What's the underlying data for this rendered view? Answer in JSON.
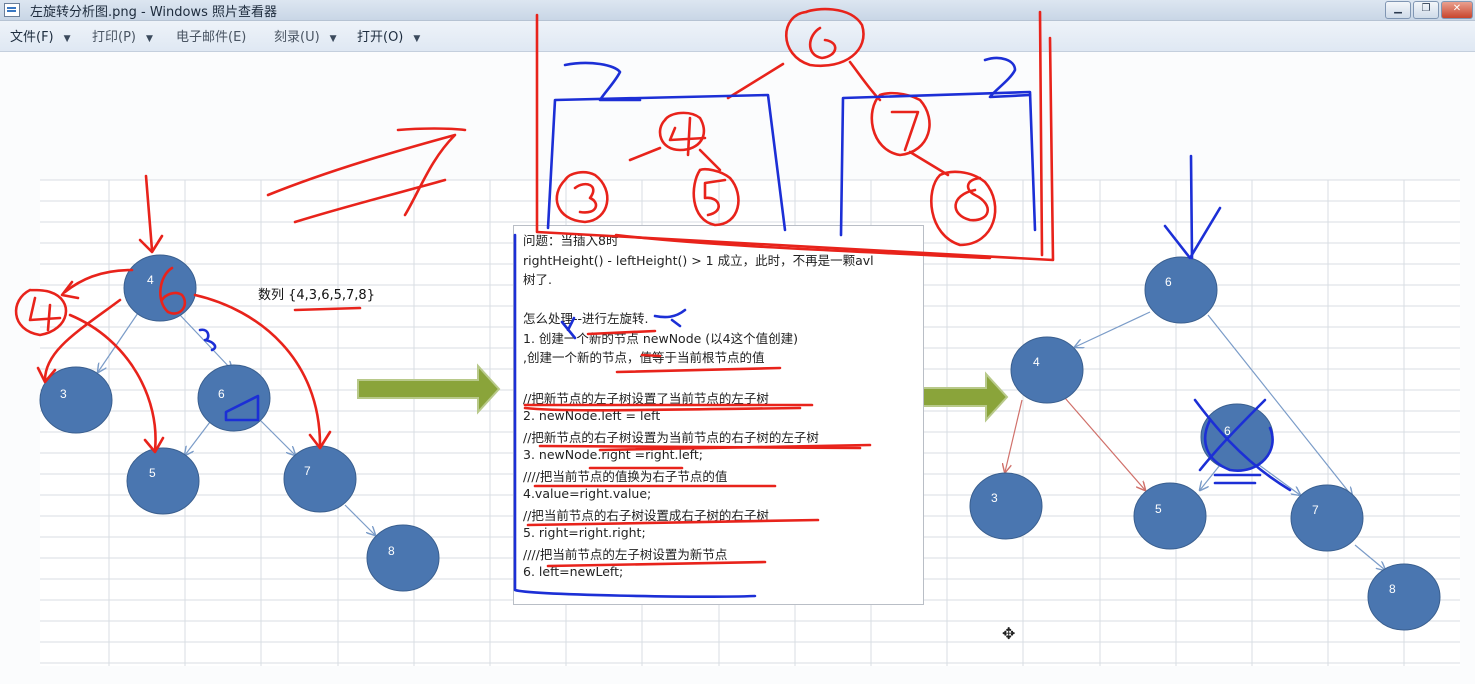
{
  "window": {
    "title": "左旋转分析图.png - Windows 照片查看器",
    "buttons": [
      "▁",
      "❐",
      "✕"
    ]
  },
  "menu": [
    {
      "label": "文件(F)",
      "arrow": "▼"
    },
    {
      "label": "打印(P)",
      "arrow": "▼"
    },
    {
      "label": "电子邮件(E)",
      "arrow": ""
    },
    {
      "label": "刻录(U)",
      "arrow": "▼"
    },
    {
      "label": "打开(O)",
      "arrow": "▼"
    }
  ],
  "sequence_label": "数列 {4,3,6,5,7,8}",
  "left_tree": {
    "nodes": [
      "4",
      "3",
      "6",
      "5",
      "7",
      "8"
    ]
  },
  "right_tree": {
    "nodes": [
      "6",
      "4",
      "6",
      "3",
      "5",
      "7",
      "8"
    ]
  },
  "annotation_digits": [
    "4",
    "6",
    "4",
    "3",
    "5",
    "7",
    "8",
    "2",
    "2"
  ],
  "explanation_lines": [
    "问题：当插入8时",
    "rightHeight() - leftHeight() > 1 成立，此时，不再是一颗avl",
    "树了.",
    "",
    "怎么处理--进行左旋转.",
    "1. 创建一个新的节点 newNode (以4这个值创建)",
    ",创建一个新的节点，值等于当前根节点的值",
    "",
    "//把新节点的左子树设置了当前节点的左子树",
    "2. newNode.left = left",
    "//把新节点的右子树设置为当前节点的右子树的左子树",
    "3. newNode.right =right.left;",
    "////把当前节点的值换为右子节点的值",
    "4.value=right.value;",
    "//把当前节点的右子树设置成右子树的右子树",
    "5. right=right.right;",
    "////把当前节点的左子树设置为新节点",
    "6. left=newLeft;"
  ],
  "colors": {
    "node_fill": "#4a76b0",
    "node_stroke": "#3a5f8f",
    "edge": "#7b9cc8",
    "red_edge": "#d0706a",
    "arrow_fill": "#8aa43a",
    "ink_red": "#e8231b",
    "ink_blue": "#1c2fd6",
    "grid": "#d8dde3"
  }
}
